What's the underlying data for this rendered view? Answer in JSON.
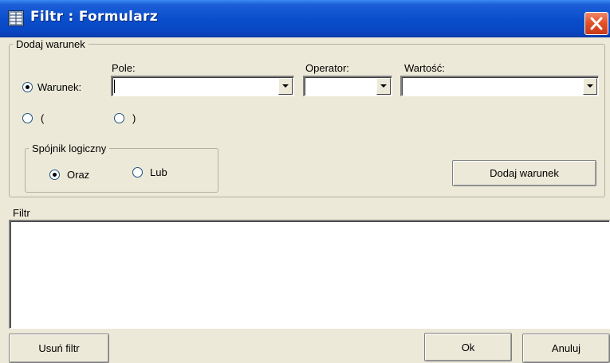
{
  "window": {
    "title": "Filtr : Formularz",
    "close_icon": "close-x-icon",
    "app_icon": "form-icon",
    "titlebar_color": "#0a4ecb",
    "close_color": "#e2542b"
  },
  "dodaj_warunek": {
    "legend": "Dodaj warunek",
    "pole_label": "Pole:",
    "operator_label": "Operator:",
    "wartosc_label": "Wartość:",
    "warunek_radio": {
      "label": "Warunek:",
      "checked": true
    },
    "open_paren_radio": {
      "label": "(",
      "checked": false
    },
    "close_paren_radio": {
      "label": ")",
      "checked": false
    },
    "pole_value": "",
    "operator_value": "",
    "wartosc_value": "",
    "spojnik": {
      "legend": "Spójnik logiczny",
      "oraz": {
        "label": "Oraz",
        "checked": true
      },
      "lub": {
        "label": "Lub",
        "checked": false
      }
    },
    "add_button": "Dodaj warunek"
  },
  "filtr": {
    "label": "Filtr",
    "text": ""
  },
  "footer": {
    "remove_button": "Usuń filtr",
    "ok_button": "Ok",
    "cancel_button": "Anuluj"
  }
}
